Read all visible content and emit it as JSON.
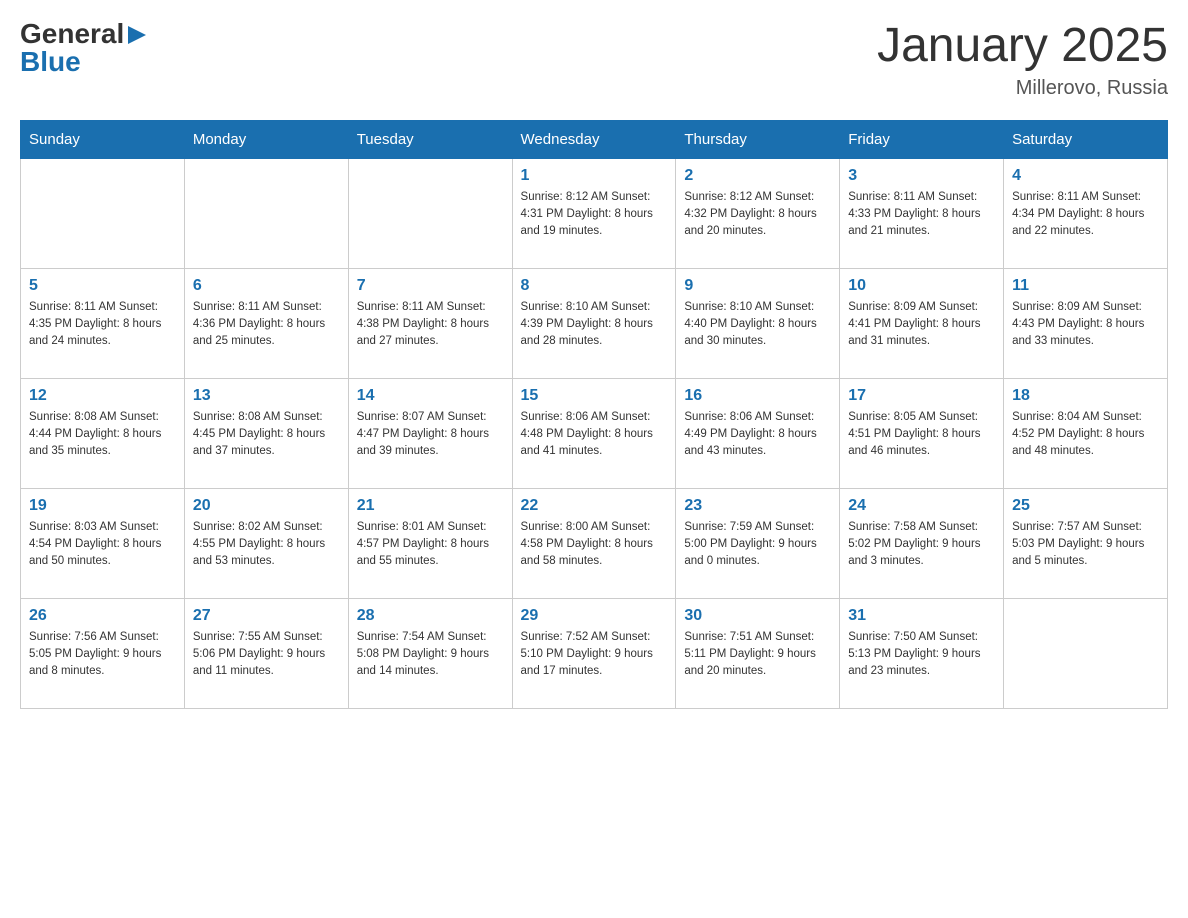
{
  "header": {
    "logo_general": "General",
    "logo_blue": "Blue",
    "month_title": "January 2025",
    "location": "Millerovo, Russia"
  },
  "weekdays": [
    "Sunday",
    "Monday",
    "Tuesday",
    "Wednesday",
    "Thursday",
    "Friday",
    "Saturday"
  ],
  "weeks": [
    [
      {
        "day": "",
        "info": ""
      },
      {
        "day": "",
        "info": ""
      },
      {
        "day": "",
        "info": ""
      },
      {
        "day": "1",
        "info": "Sunrise: 8:12 AM\nSunset: 4:31 PM\nDaylight: 8 hours\nand 19 minutes."
      },
      {
        "day": "2",
        "info": "Sunrise: 8:12 AM\nSunset: 4:32 PM\nDaylight: 8 hours\nand 20 minutes."
      },
      {
        "day": "3",
        "info": "Sunrise: 8:11 AM\nSunset: 4:33 PM\nDaylight: 8 hours\nand 21 minutes."
      },
      {
        "day": "4",
        "info": "Sunrise: 8:11 AM\nSunset: 4:34 PM\nDaylight: 8 hours\nand 22 minutes."
      }
    ],
    [
      {
        "day": "5",
        "info": "Sunrise: 8:11 AM\nSunset: 4:35 PM\nDaylight: 8 hours\nand 24 minutes."
      },
      {
        "day": "6",
        "info": "Sunrise: 8:11 AM\nSunset: 4:36 PM\nDaylight: 8 hours\nand 25 minutes."
      },
      {
        "day": "7",
        "info": "Sunrise: 8:11 AM\nSunset: 4:38 PM\nDaylight: 8 hours\nand 27 minutes."
      },
      {
        "day": "8",
        "info": "Sunrise: 8:10 AM\nSunset: 4:39 PM\nDaylight: 8 hours\nand 28 minutes."
      },
      {
        "day": "9",
        "info": "Sunrise: 8:10 AM\nSunset: 4:40 PM\nDaylight: 8 hours\nand 30 minutes."
      },
      {
        "day": "10",
        "info": "Sunrise: 8:09 AM\nSunset: 4:41 PM\nDaylight: 8 hours\nand 31 minutes."
      },
      {
        "day": "11",
        "info": "Sunrise: 8:09 AM\nSunset: 4:43 PM\nDaylight: 8 hours\nand 33 minutes."
      }
    ],
    [
      {
        "day": "12",
        "info": "Sunrise: 8:08 AM\nSunset: 4:44 PM\nDaylight: 8 hours\nand 35 minutes."
      },
      {
        "day": "13",
        "info": "Sunrise: 8:08 AM\nSunset: 4:45 PM\nDaylight: 8 hours\nand 37 minutes."
      },
      {
        "day": "14",
        "info": "Sunrise: 8:07 AM\nSunset: 4:47 PM\nDaylight: 8 hours\nand 39 minutes."
      },
      {
        "day": "15",
        "info": "Sunrise: 8:06 AM\nSunset: 4:48 PM\nDaylight: 8 hours\nand 41 minutes."
      },
      {
        "day": "16",
        "info": "Sunrise: 8:06 AM\nSunset: 4:49 PM\nDaylight: 8 hours\nand 43 minutes."
      },
      {
        "day": "17",
        "info": "Sunrise: 8:05 AM\nSunset: 4:51 PM\nDaylight: 8 hours\nand 46 minutes."
      },
      {
        "day": "18",
        "info": "Sunrise: 8:04 AM\nSunset: 4:52 PM\nDaylight: 8 hours\nand 48 minutes."
      }
    ],
    [
      {
        "day": "19",
        "info": "Sunrise: 8:03 AM\nSunset: 4:54 PM\nDaylight: 8 hours\nand 50 minutes."
      },
      {
        "day": "20",
        "info": "Sunrise: 8:02 AM\nSunset: 4:55 PM\nDaylight: 8 hours\nand 53 minutes."
      },
      {
        "day": "21",
        "info": "Sunrise: 8:01 AM\nSunset: 4:57 PM\nDaylight: 8 hours\nand 55 minutes."
      },
      {
        "day": "22",
        "info": "Sunrise: 8:00 AM\nSunset: 4:58 PM\nDaylight: 8 hours\nand 58 minutes."
      },
      {
        "day": "23",
        "info": "Sunrise: 7:59 AM\nSunset: 5:00 PM\nDaylight: 9 hours\nand 0 minutes."
      },
      {
        "day": "24",
        "info": "Sunrise: 7:58 AM\nSunset: 5:02 PM\nDaylight: 9 hours\nand 3 minutes."
      },
      {
        "day": "25",
        "info": "Sunrise: 7:57 AM\nSunset: 5:03 PM\nDaylight: 9 hours\nand 5 minutes."
      }
    ],
    [
      {
        "day": "26",
        "info": "Sunrise: 7:56 AM\nSunset: 5:05 PM\nDaylight: 9 hours\nand 8 minutes."
      },
      {
        "day": "27",
        "info": "Sunrise: 7:55 AM\nSunset: 5:06 PM\nDaylight: 9 hours\nand 11 minutes."
      },
      {
        "day": "28",
        "info": "Sunrise: 7:54 AM\nSunset: 5:08 PM\nDaylight: 9 hours\nand 14 minutes."
      },
      {
        "day": "29",
        "info": "Sunrise: 7:52 AM\nSunset: 5:10 PM\nDaylight: 9 hours\nand 17 minutes."
      },
      {
        "day": "30",
        "info": "Sunrise: 7:51 AM\nSunset: 5:11 PM\nDaylight: 9 hours\nand 20 minutes."
      },
      {
        "day": "31",
        "info": "Sunrise: 7:50 AM\nSunset: 5:13 PM\nDaylight: 9 hours\nand 23 minutes."
      },
      {
        "day": "",
        "info": ""
      }
    ]
  ]
}
